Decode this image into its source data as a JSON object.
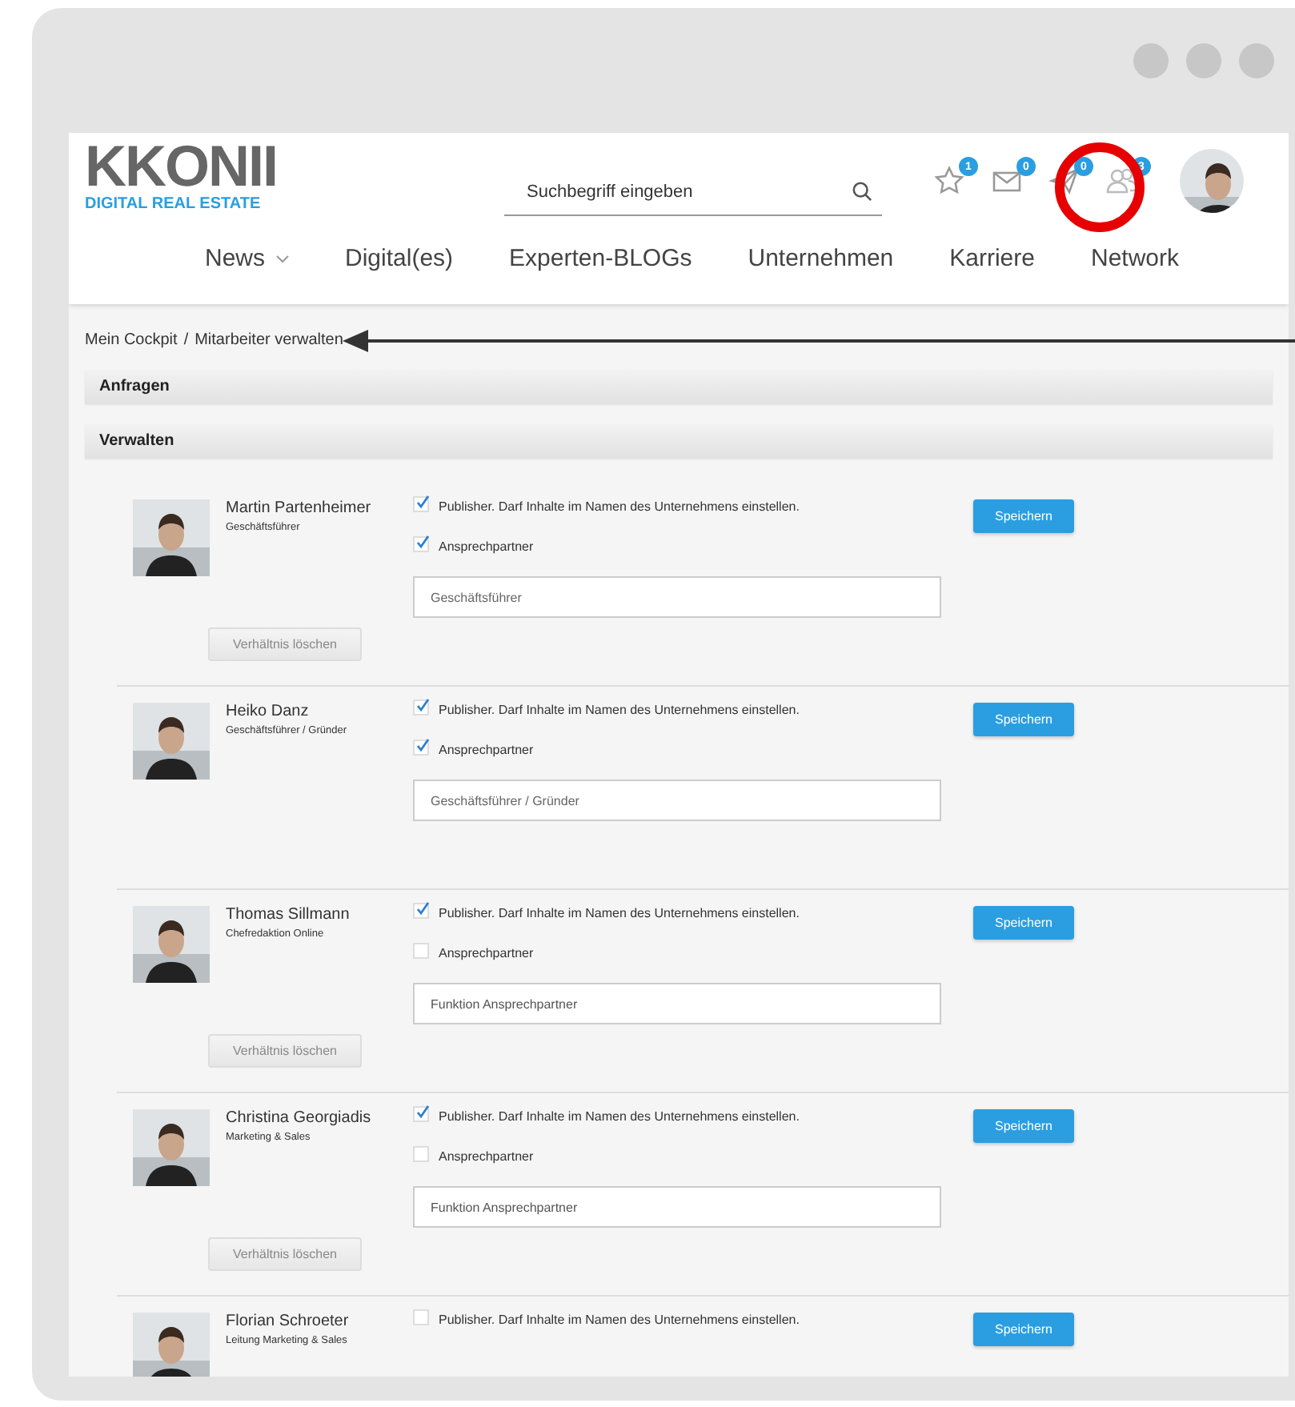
{
  "header": {
    "logo": {
      "name": "KKONII",
      "tagline": "DIGITAL REAL ESTATE"
    },
    "search": {
      "placeholder": "Suchbegriff eingeben"
    },
    "icons": [
      {
        "kind": "star",
        "badge": "1"
      },
      {
        "kind": "mail",
        "badge": "0"
      },
      {
        "kind": "send",
        "badge": "0"
      },
      {
        "kind": "people",
        "badge": "3"
      }
    ],
    "nav": [
      {
        "label": "News",
        "dropdown": true
      },
      {
        "label": "Digital(es)",
        "dropdown": false
      },
      {
        "label": "Experten-BLOGs",
        "dropdown": false
      },
      {
        "label": "Unternehmen",
        "dropdown": false
      },
      {
        "label": "Karriere",
        "dropdown": false
      },
      {
        "label": "Network",
        "dropdown": false
      }
    ]
  },
  "breadcrumb": [
    "Mein Cockpit",
    "/",
    "Mitarbeiter verwalten"
  ],
  "sections": [
    "Anfragen",
    "Verwalten"
  ],
  "members": [
    {
      "name": "Martin Partenheimer",
      "role": "Geschäftsführer",
      "publisher_label": "Publisher. Darf Inhalte im Namen des Unternehmens einstellen.",
      "publisher": true,
      "contact_label": "Ansprechpartner",
      "contact": true,
      "field": {
        "value": "Geschäftsführer"
      },
      "save": "Speichern",
      "remove": "Verhältnis löschen"
    },
    {
      "name": "Heiko Danz",
      "role": "Geschäftsführer / Gründer",
      "publisher_label": "Publisher. Darf Inhalte im Namen des Unternehmens einstellen.",
      "publisher": true,
      "contact_label": "Ansprechpartner",
      "contact": true,
      "field": {
        "value": "Geschäftsführer / Gründer"
      },
      "save": "Speichern"
    },
    {
      "name": "Thomas Sillmann",
      "role": "Chefredaktion Online",
      "publisher_label": "Publisher. Darf Inhalte im Namen des Unternehmens einstellen.",
      "publisher": true,
      "contact_label": "Ansprechpartner",
      "contact": false,
      "field": {
        "placeholder": "Funktion Ansprechpartner"
      },
      "save": "Speichern",
      "remove": "Verhältnis löschen"
    },
    {
      "name": "Christina Georgiadis",
      "role": "Marketing & Sales",
      "publisher_label": "Publisher. Darf Inhalte im Namen des Unternehmens einstellen.",
      "publisher": true,
      "contact_label": "Ansprechpartner",
      "contact": false,
      "field": {
        "placeholder": "Funktion Ansprechpartner"
      },
      "save": "Speichern",
      "remove": "Verhältnis löschen"
    },
    {
      "name": "Florian Schroeter",
      "role": "Leitung Marketing & Sales",
      "publisher_label": "Publisher. Darf Inhalte im Namen des Unternehmens einstellen.",
      "publisher": false,
      "save": "Speichern"
    }
  ]
}
